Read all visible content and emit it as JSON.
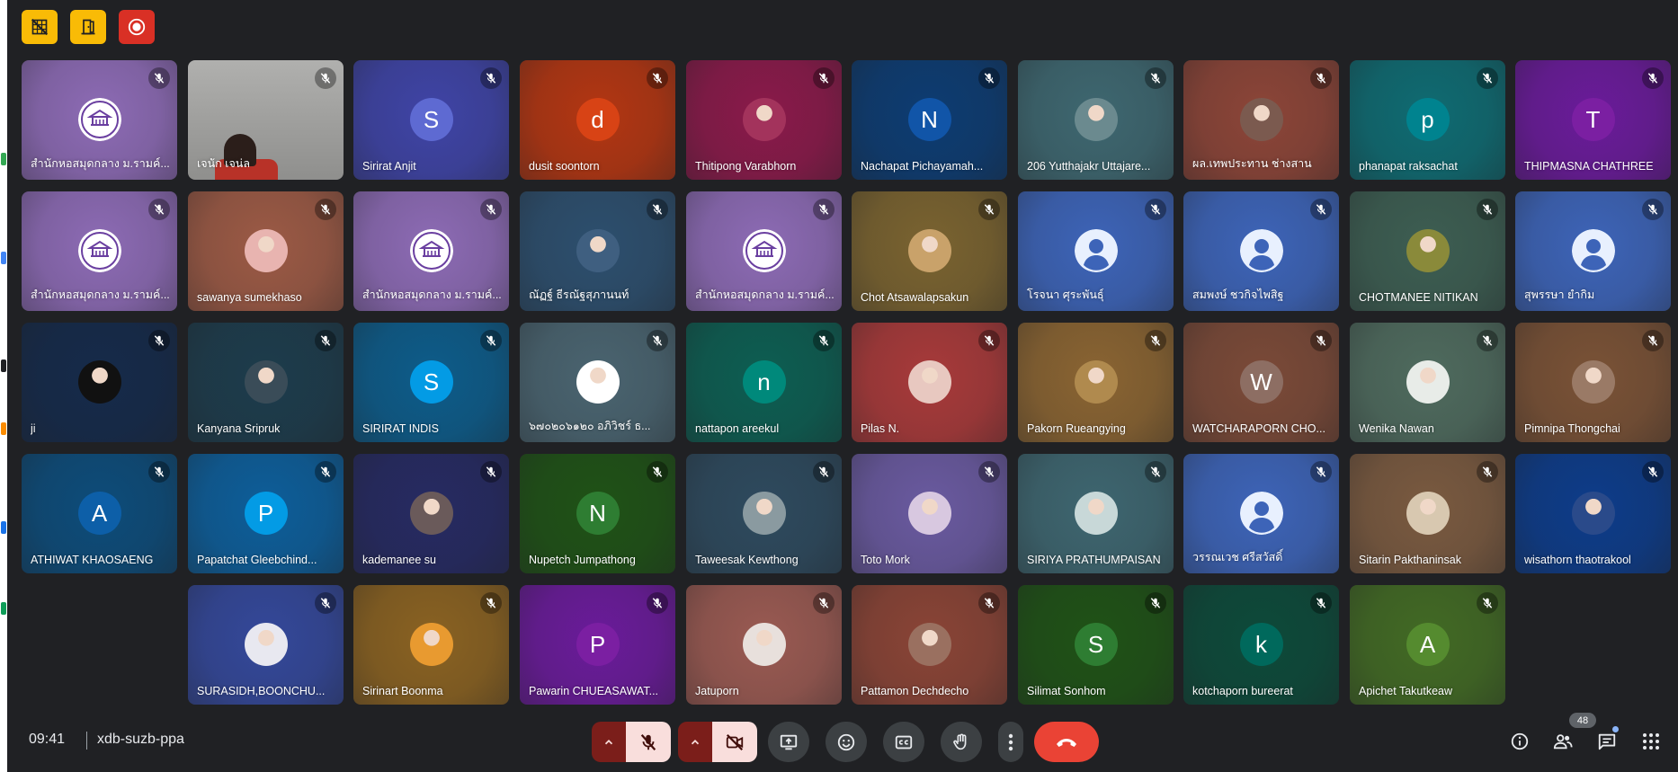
{
  "meeting": {
    "time": "09:41",
    "code": "xdb-suzb-ppa",
    "people_count": "48"
  },
  "tiles": [
    {
      "name": "สำนักหอสมุดกลาง ม.รามค์...",
      "bg": "#8d6bb5",
      "avatar": "logo"
    },
    {
      "name": "เจนัก เจน่ล",
      "bg": "#9e9e9e",
      "avatar": "video"
    },
    {
      "name": "Sirirat Anjit",
      "bg": "#3f44a6",
      "avatar": "letter",
      "letter": "S",
      "ac": "#5e6ad2"
    },
    {
      "name": "dusit soontorn",
      "bg": "#b33612",
      "avatar": "letter",
      "letter": "d",
      "ac": "#d84315"
    },
    {
      "name": "Thitipong Varabhorn",
      "bg": "#8a1a4a",
      "avatar": "photo",
      "ac": "#a3335c"
    },
    {
      "name": "Nachapat Pichayamah...",
      "bg": "#0d3c72",
      "avatar": "letter",
      "letter": "N",
      "ac": "#1155a8"
    },
    {
      "name": "206 Yutthajakr Uttajare...",
      "bg": "#3e6770",
      "avatar": "photo",
      "ac": "#6b8a8f"
    },
    {
      "name": "ผล.เทพประทาน ช่างสาน",
      "bg": "#8c4538",
      "avatar": "photo",
      "ac": "#7b5a4f"
    },
    {
      "name": "phanapat raksachat",
      "bg": "#0f6b72",
      "avatar": "letter",
      "letter": "p",
      "ac": "#00838f"
    },
    {
      "name": "THIPMASNA CHATHREE",
      "bg": "#6a1b9a",
      "avatar": "letter",
      "letter": "T",
      "ac": "#7b1fa2"
    },
    {
      "name": "สำนักหอสมุดกลาง ม.รามค์...",
      "bg": "#8d6bb5",
      "avatar": "logo"
    },
    {
      "name": "sawanya sumekhaso",
      "bg": "#9c5a45",
      "avatar": "photo",
      "ac": "#e8b4b0"
    },
    {
      "name": "สำนักหอสมุดกลาง ม.รามค์...",
      "bg": "#8d6bb5",
      "avatar": "logo"
    },
    {
      "name": "ณัฏฐ์ ธีรณัฐสุภานนท์",
      "bg": "#2d4f6e",
      "avatar": "photo",
      "ac": "#3f5f80"
    },
    {
      "name": "สำนักหอสมุดกลาง ม.รามค์...",
      "bg": "#8d6bb5",
      "avatar": "logo"
    },
    {
      "name": "Chot Atsawalapsakun",
      "bg": "#7a6330",
      "avatar": "photo",
      "ac": "#c9a26a"
    },
    {
      "name": "โรจนา ศุระพันธุ์",
      "bg": "#3d64b8",
      "avatar": "person"
    },
    {
      "name": "สมพงษ์ ชวกิจไพสิฐ",
      "bg": "#3d64b8",
      "avatar": "person"
    },
    {
      "name": "CHOTMANEE NITIKAN",
      "bg": "#3d5e52",
      "avatar": "photo",
      "ac": "#8a8a3a"
    },
    {
      "name": "สุพรรษา ยำกิม",
      "bg": "#3d64b8",
      "avatar": "person"
    },
    {
      "name": "ji",
      "bg": "#152a4a",
      "avatar": "photo",
      "ac": "#111111"
    },
    {
      "name": "Kanyana Sripruk",
      "bg": "#1d3c4c",
      "avatar": "photo",
      "ac": "#3a4c58"
    },
    {
      "name": "SIRIRAT INDIS",
      "bg": "#0d5c8a",
      "avatar": "letter",
      "letter": "S",
      "ac": "#039be5"
    },
    {
      "name": "๖๗๐๒๐๖๑๒๐ อภิวิชร์ ธ...",
      "bg": "#4a6470",
      "avatar": "photo",
      "ac": "#ffffff"
    },
    {
      "name": "nattapon areekul",
      "bg": "#0d5e52",
      "avatar": "letter",
      "letter": "n",
      "ac": "#00897b"
    },
    {
      "name": "Pilas N.",
      "bg": "#a83a3a",
      "avatar": "photo",
      "ac": "#e8c8c0"
    },
    {
      "name": "Pakorn Rueangying",
      "bg": "#8a6432",
      "avatar": "photo",
      "ac": "#b08a4e"
    },
    {
      "name": "WATCHARAPORN CHO...",
      "bg": "#7b4a38",
      "avatar": "letter",
      "letter": "W",
      "ac": "#8d6e63"
    },
    {
      "name": "Wenika Nawan",
      "bg": "#4f6b5e",
      "avatar": "photo",
      "ac": "#e8ece8"
    },
    {
      "name": "Pimnipa Thongchai",
      "bg": "#7a5236",
      "avatar": "photo",
      "ac": "#9a7a66"
    },
    {
      "name": "ATHIWAT KHAOSAENG",
      "bg": "#0d4c7a",
      "avatar": "letter",
      "letter": "A",
      "ac": "#0d5fa8"
    },
    {
      "name": "Papatchat Gleebchind...",
      "bg": "#0d5e9a",
      "avatar": "letter",
      "letter": "P",
      "ac": "#039be5"
    },
    {
      "name": "kademanee su",
      "bg": "#262a62",
      "avatar": "photo",
      "ac": "#6a5a5a"
    },
    {
      "name": "Nupetch Jumpathong",
      "bg": "#1f5216",
      "avatar": "letter",
      "letter": "N",
      "ac": "#2e7d32"
    },
    {
      "name": "Taweesak Kewthong",
      "bg": "#2e4a5e",
      "avatar": "photo",
      "ac": "#8a9aa0"
    },
    {
      "name": "Toto Mork",
      "bg": "#6a5aa0",
      "avatar": "photo",
      "ac": "#d8c8e0"
    },
    {
      "name": "SIRIYA PRATHUMPAISAN",
      "bg": "#3e6670",
      "avatar": "photo",
      "ac": "#c8d8d8"
    },
    {
      "name": "วรรณเวช ศรีสวัสดิ์",
      "bg": "#3d64b8",
      "avatar": "person"
    },
    {
      "name": "Sitarin Pakthaninsak",
      "bg": "#7a5a40",
      "avatar": "photo",
      "ac": "#d8c8b0"
    },
    {
      "name": "wisathorn thaotrakool",
      "bg": "#0d3c8a",
      "avatar": "photo",
      "ac": "#2a4a8a"
    },
    {
      "name": "SURASIDH,BOONCHU...",
      "bg": "#34489a",
      "avatar": "photo",
      "ac": "#e8e8f0"
    },
    {
      "name": "Sirinart Boonma",
      "bg": "#8a6222",
      "avatar": "photo",
      "ac": "#e89a30"
    },
    {
      "name": "Pawarin CHUEASAWAT...",
      "bg": "#6a1b9a",
      "avatar": "letter",
      "letter": "P",
      "ac": "#7b1fa2"
    },
    {
      "name": "Jatuporn",
      "bg": "#9a5a52",
      "avatar": "photo",
      "ac": "#e8e0dc"
    },
    {
      "name": "Pattamon Dechdecho",
      "bg": "#8a4436",
      "avatar": "photo",
      "ac": "#9a7060"
    },
    {
      "name": "Silimat Sonhom",
      "bg": "#1f5216",
      "avatar": "letter",
      "letter": "S",
      "ac": "#2e7d32"
    },
    {
      "name": "kotchaporn bureerat",
      "bg": "#0d4a3a",
      "avatar": "letter",
      "letter": "k",
      "ac": "#00695c"
    },
    {
      "name": "Apichet Takutkeaw",
      "bg": "#426a24",
      "avatar": "letter",
      "letter": "A",
      "ac": "#558b2f"
    }
  ]
}
